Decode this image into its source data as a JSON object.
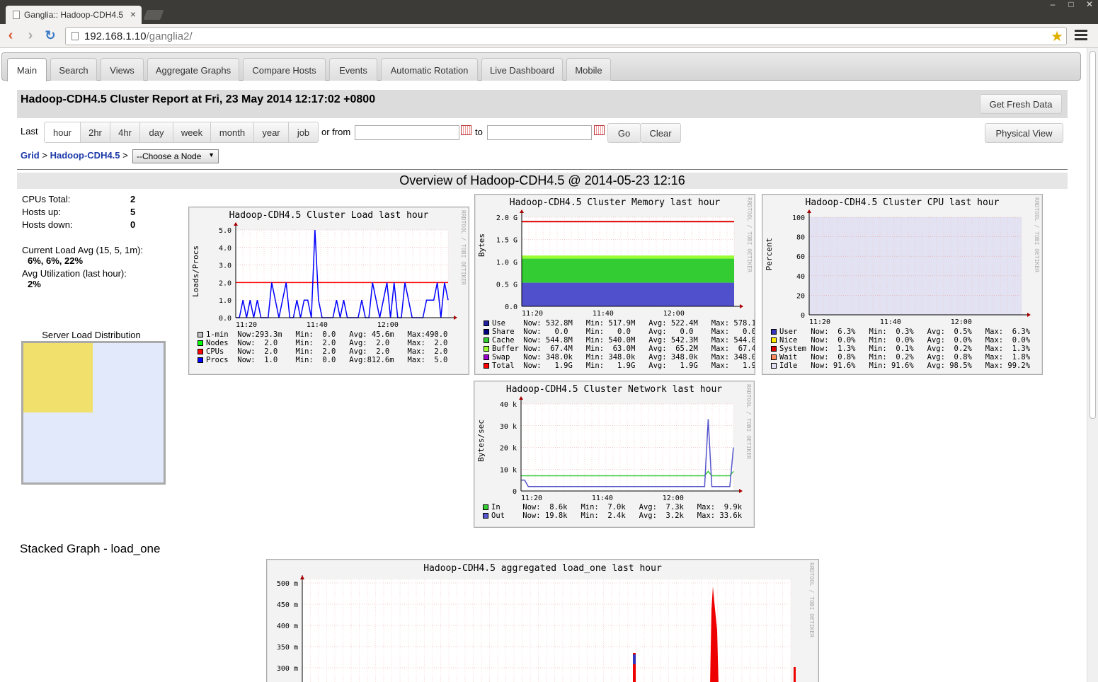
{
  "browser": {
    "tab_title": "Ganglia:: Hadoop-CDH4.5",
    "tab_close": "×",
    "url_host": "192.168.1.10",
    "url_path": "/ganglia2/"
  },
  "nav_tabs": [
    "Main",
    "Search",
    "Views",
    "Aggregate Graphs",
    "Compare Hosts",
    "Events",
    "Automatic Rotation",
    "Live Dashboard",
    "Mobile"
  ],
  "report": {
    "title": "Hadoop-CDH4.5 Cluster Report at Fri, 23 May 2014 12:17:02 +0800",
    "fresh_button": "Get Fresh Data",
    "physical_view": "Physical View"
  },
  "range": {
    "last_label": "Last",
    "options": [
      "hour",
      "2hr",
      "4hr",
      "day",
      "week",
      "month",
      "year",
      "job"
    ],
    "active": "hour",
    "from_label": "or from",
    "to_label": "to",
    "from_value": "",
    "to_value": "",
    "go": "Go",
    "clear": "Clear"
  },
  "breadcrumb": {
    "grid": "Grid",
    "sep": ">",
    "cluster": "Hadoop-CDH4.5",
    "node_select": "--Choose a Node"
  },
  "overview_title": "Overview of Hadoop-CDH4.5 @ 2014-05-23 12:16",
  "stats": {
    "cpus_label": "CPUs Total:",
    "cpus": "2",
    "up_label": "Hosts up:",
    "up": "5",
    "down_label": "Hosts down:",
    "down": "0",
    "load_label": "Current Load Avg (15, 5, 1m):",
    "load": "6%, 6%, 22%",
    "util_label": "Avg Utilization (last hour):",
    "util": "2%"
  },
  "server_load_title": "Server Load Distribution",
  "stacked_title": "Stacked Graph - load_one",
  "colors": {
    "accent_link": "#1c3aa9",
    "red": "#ff0000",
    "blue": "#0000ff",
    "green": "#33cc33",
    "highlight": "#f2e06c"
  },
  "chart_data": [
    {
      "id": "load",
      "type": "line",
      "title": "Hadoop-CDH4.5 Cluster Load last hour",
      "ylabel": "Loads/Procs",
      "rrd": "RRDTOOL / TOBI OETIKER",
      "ylim": [
        0,
        5
      ],
      "yticks": [
        "0.0",
        "1.0",
        "2.0",
        "3.0",
        "4.0",
        "5.0"
      ],
      "xticks": [
        "11:20",
        "11:40",
        "12:00"
      ],
      "series": [
        {
          "name": "CPUs",
          "color": "#ff0000",
          "values": [
            2,
            2,
            2,
            2,
            2,
            2,
            2,
            2,
            2,
            2,
            2,
            2,
            2,
            2,
            2,
            2,
            2,
            2,
            2,
            2,
            2,
            2,
            2,
            2,
            2,
            2,
            2,
            2,
            2,
            2,
            2,
            2,
            2,
            2,
            2,
            2,
            2,
            2,
            2,
            2,
            2,
            2,
            2,
            2,
            2,
            2,
            2,
            2,
            2,
            2,
            2,
            2,
            2,
            2,
            2,
            2,
            2,
            2,
            2,
            2
          ]
        },
        {
          "name": "Procs",
          "color": "#0000ff",
          "values": [
            0,
            0,
            1,
            0,
            1,
            0,
            1,
            0,
            0,
            0,
            2,
            1,
            0,
            1,
            2,
            0,
            0,
            1,
            0,
            1,
            1,
            0,
            5,
            1,
            0,
            0,
            0,
            0,
            1,
            0,
            1,
            0,
            0,
            0,
            0,
            1,
            0,
            0,
            2,
            1,
            0,
            1,
            2,
            0,
            2,
            0,
            0,
            2,
            1,
            0,
            0,
            0,
            0,
            1,
            1,
            1,
            2,
            0,
            2,
            1
          ]
        }
      ],
      "legend": [
        {
          "name": "1-min",
          "color": "#c0c0c0",
          "text": "Now:293.3m   Min:  0.0   Avg: 45.6m   Max:490.0"
        },
        {
          "name": "Nodes",
          "color": "#00ff00",
          "text": "Now:  2.0    Min:  2.0   Avg:  2.0    Max:  2.0"
        },
        {
          "name": "CPUs",
          "color": "#ff0000",
          "text": "Now:  2.0    Min:  2.0   Avg:  2.0    Max:  2.0"
        },
        {
          "name": "Procs",
          "color": "#0000ff",
          "text": "Now:  1.0    Min:  0.0   Avg:812.6m   Max:  5.0"
        }
      ]
    },
    {
      "id": "memory",
      "type": "area",
      "title": "Hadoop-CDH4.5 Cluster Memory last hour",
      "ylabel": "Bytes",
      "rrd": "RRDTOOL / TOBI OETIKER",
      "ylim": [
        0,
        2.0
      ],
      "yticks": [
        "0.0",
        "0.5 G",
        "1.0 G",
        "1.5 G",
        "2.0 G"
      ],
      "xticks": [
        "11:20",
        "11:40",
        "12:00"
      ],
      "values": {
        "use_g": 0.53,
        "cache_g": 0.54,
        "buffer_g": 0.07,
        "total_g": 1.9
      },
      "legend": [
        {
          "name": "Use",
          "color": "#1f1f9f",
          "text": "Now: 532.8M   Min: 517.9M   Avg: 522.4M   Max: 578.1M"
        },
        {
          "name": "Share",
          "color": "#000080",
          "text": "Now:   0.0    Min:   0.0    Avg:   0.0    Max:   0.0"
        },
        {
          "name": "Cache",
          "color": "#33cc33",
          "text": "Now: 544.8M   Min: 540.0M   Avg: 542.3M   Max: 544.8M"
        },
        {
          "name": "Buffer",
          "color": "#99ff33",
          "text": "Now:  67.4M   Min:  63.0M   Avg:  65.2M   Max:  67.4M"
        },
        {
          "name": "Swap",
          "color": "#9900cc",
          "text": "Now: 348.0k   Min: 348.0k   Avg: 348.0k   Max: 348.0k"
        },
        {
          "name": "Total",
          "color": "#ff0000",
          "text": "Now:   1.9G   Min:   1.9G   Avg:   1.9G   Max:   1.9G"
        }
      ]
    },
    {
      "id": "cpu",
      "type": "area",
      "title": "Hadoop-CDH4.5 Cluster CPU last hour",
      "ylabel": "Percent",
      "rrd": "RRDTOOL / TOBI OETIKER",
      "ylim": [
        0,
        100
      ],
      "yticks": [
        "0",
        "20",
        "40",
        "60",
        "80",
        "100"
      ],
      "xticks": [
        "11:20",
        "11:40",
        "12:00"
      ],
      "legend": [
        {
          "name": "User",
          "color": "#3333bb",
          "text": "Now:  6.3%   Min:  0.3%   Avg:  0.5%   Max:  6.3%"
        },
        {
          "name": "Nice",
          "color": "#ffea00",
          "text": "Now:  0.0%   Min:  0.0%   Avg:  0.0%   Max:  0.0%"
        },
        {
          "name": "System",
          "color": "#dd0000",
          "text": "Now:  1.3%   Min:  0.1%   Avg:  0.2%   Max:  1.3%"
        },
        {
          "name": "Wait",
          "color": "#ff8a60",
          "text": "Now:  0.8%   Min:  0.2%   Avg:  0.8%   Max:  1.8%"
        },
        {
          "name": "Idle",
          "color": "#e2e2f2",
          "text": "Now: 91.6%   Min: 91.6%   Avg: 98.5%   Max: 99.2%"
        }
      ]
    },
    {
      "id": "network",
      "type": "line",
      "title": "Hadoop-CDH4.5 Cluster Network last hour",
      "ylabel": "Bytes/sec",
      "rrd": "RRDTOOL / TOBI OETIKER",
      "ylim": [
        0,
        40000
      ],
      "yticks": [
        "0",
        "10 k",
        "20 k",
        "30 k",
        "40 k"
      ],
      "xticks": [
        "11:20",
        "11:40",
        "12:00"
      ],
      "series": [
        {
          "name": "In",
          "color": "#33cc33",
          "values": [
            7,
            7,
            7,
            7,
            7,
            7,
            7,
            7,
            7,
            7,
            7,
            7,
            7,
            7,
            7,
            7,
            7,
            7,
            7,
            7,
            7,
            7,
            7,
            7,
            7,
            7,
            7,
            7,
            7,
            7,
            7,
            7,
            7,
            7,
            7,
            7,
            7,
            7,
            7,
            7,
            7,
            7,
            7,
            7,
            7,
            7,
            7,
            7,
            7,
            7,
            7,
            7,
            9,
            7,
            7,
            7,
            7,
            7,
            7,
            9
          ]
        },
        {
          "name": "Out",
          "color": "#5555cc",
          "values": [
            5,
            5,
            2,
            2,
            2,
            2,
            2,
            2,
            2,
            2,
            2,
            2,
            2,
            2,
            2,
            2,
            2,
            2,
            2,
            2,
            2,
            2,
            2,
            2,
            2,
            2,
            2,
            2,
            2,
            2,
            2,
            2,
            2,
            2,
            2,
            2,
            2,
            2,
            2,
            2,
            2,
            2,
            2,
            2,
            2,
            2,
            2,
            2,
            2,
            2,
            2,
            2,
            33,
            2,
            2,
            2,
            2,
            2,
            2,
            20
          ]
        }
      ],
      "legend": [
        {
          "name": "In",
          "color": "#33cc33",
          "text": "Now:  8.6k   Min:  7.0k   Avg:  7.3k   Max:  9.9k"
        },
        {
          "name": "Out",
          "color": "#5555cc",
          "text": "Now: 19.8k   Min:  2.4k   Avg:  3.2k   Max: 33.6k"
        }
      ]
    },
    {
      "id": "stacked",
      "type": "area",
      "title": "Hadoop-CDH4.5 aggregated load_one last hour",
      "rrd": "RRDTOOL / TOBI OETIKER",
      "yticks": [
        "300 m",
        "350 m",
        "400 m",
        "450 m",
        "500 m"
      ]
    }
  ]
}
